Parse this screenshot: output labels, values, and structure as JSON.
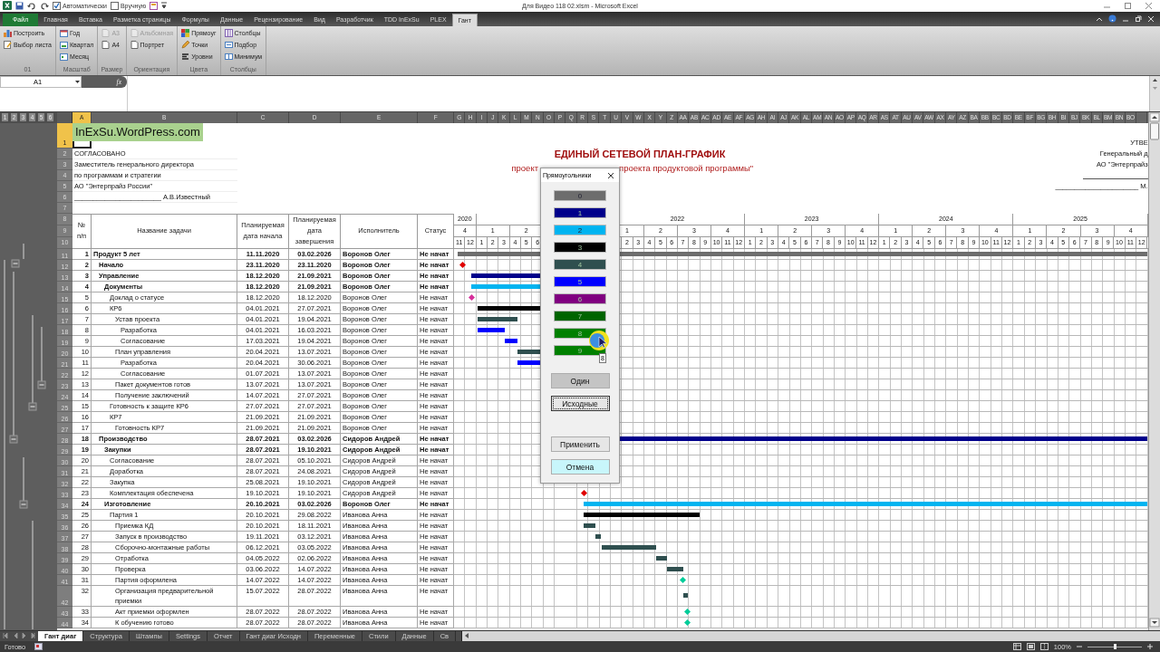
{
  "title_bar": {
    "title": "Для Видео 118 02.xlsm - Microsoft Excel",
    "checks": [
      {
        "label": "Автоматически",
        "checked": true
      },
      {
        "label": "Вручную",
        "checked": false
      }
    ]
  },
  "ribbon": {
    "tabs": [
      {
        "label": "Файл",
        "kind": "file",
        "selected": false
      },
      {
        "label": "Главная",
        "kind": "tab",
        "selected": false
      },
      {
        "label": "Вставка",
        "kind": "tab",
        "selected": false
      },
      {
        "label": "Разметка страницы",
        "kind": "tab",
        "selected": false
      },
      {
        "label": "Формулы",
        "kind": "tab",
        "selected": false
      },
      {
        "label": "Данные",
        "kind": "tab",
        "selected": false
      },
      {
        "label": "Рецензирование",
        "kind": "tab",
        "selected": false
      },
      {
        "label": "Вид",
        "kind": "tab",
        "selected": false
      },
      {
        "label": "Разработчик",
        "kind": "tab",
        "selected": false
      },
      {
        "label": "TDD InExSu",
        "kind": "tab",
        "selected": false
      },
      {
        "label": "PLEX",
        "kind": "tab",
        "selected": false
      },
      {
        "label": "Гант",
        "kind": "tab",
        "selected": true
      }
    ],
    "groups": [
      {
        "label": "01",
        "buttons": [
          {
            "label": "Построить",
            "disabled": false
          },
          {
            "label": "Выбор листа",
            "disabled": false
          }
        ]
      },
      {
        "label": "Масштаб",
        "buttons": [
          {
            "label": "Год",
            "disabled": false
          },
          {
            "label": "Квартал",
            "disabled": false
          },
          {
            "label": "Месяц",
            "disabled": false
          }
        ]
      },
      {
        "label": "Размер",
        "buttons": [
          {
            "label": "A3",
            "disabled": true
          },
          {
            "label": "A4",
            "disabled": false
          }
        ]
      },
      {
        "label": "Ориентация",
        "buttons": [
          {
            "label": "Альбомная",
            "disabled": true
          },
          {
            "label": "Портрет",
            "disabled": false
          }
        ]
      },
      {
        "label": "Цвета",
        "buttons": [
          {
            "label": "Прямоуг",
            "disabled": false
          },
          {
            "label": "Точки",
            "disabled": false
          },
          {
            "label": "Уровни",
            "disabled": false
          }
        ]
      },
      {
        "label": "Столбцы",
        "buttons": [
          {
            "label": "Столбцы",
            "disabled": false
          },
          {
            "label": "Подбор",
            "disabled": false
          },
          {
            "label": "Минимум",
            "disabled": false
          }
        ]
      }
    ]
  },
  "formula_bar": {
    "name_box": "A1",
    "fx": "fx"
  },
  "sheet": {
    "outline_levels": [
      "1",
      "2",
      "3",
      "4",
      "5",
      "6"
    ],
    "columns": [
      {
        "label": "A",
        "selected": true
      },
      {
        "label": "B",
        "selected": false
      },
      {
        "label": "C",
        "selected": false
      },
      {
        "label": "D",
        "selected": false
      },
      {
        "label": "E",
        "selected": false
      },
      {
        "label": "F",
        "selected": false
      },
      {
        "label": "G",
        "selected": false
      },
      {
        "label": "H",
        "selected": false
      },
      {
        "label": "I",
        "selected": false
      },
      {
        "label": "J",
        "selected": false
      },
      {
        "label": "K",
        "selected": false
      },
      {
        "label": "L",
        "selected": false
      },
      {
        "label": "M",
        "selected": false
      },
      {
        "label": "N",
        "selected": false
      },
      {
        "label": "O",
        "selected": false
      },
      {
        "label": "P",
        "selected": false
      },
      {
        "label": "Q",
        "selected": false
      },
      {
        "label": "R",
        "selected": false
      },
      {
        "label": "S",
        "selected": false
      },
      {
        "label": "T",
        "selected": false
      },
      {
        "label": "U",
        "selected": false
      },
      {
        "label": "V",
        "selected": false
      },
      {
        "label": "W",
        "selected": false
      },
      {
        "label": "X",
        "selected": false
      },
      {
        "label": "Y",
        "selected": false
      },
      {
        "label": "Z",
        "selected": false
      },
      {
        "label": "AA",
        "selected": false
      },
      {
        "label": "AB",
        "selected": false
      },
      {
        "label": "AC",
        "selected": false
      },
      {
        "label": "AD",
        "selected": false
      },
      {
        "label": "AE",
        "selected": false
      },
      {
        "label": "AF",
        "selected": false
      },
      {
        "label": "AG",
        "selected": false
      },
      {
        "label": "AH",
        "selected": false
      },
      {
        "label": "AI",
        "selected": false
      },
      {
        "label": "AJ",
        "selected": false
      },
      {
        "label": "AK",
        "selected": false
      },
      {
        "label": "AL",
        "selected": false
      },
      {
        "label": "AM",
        "selected": false
      },
      {
        "label": "AN",
        "selected": false
      },
      {
        "label": "AO",
        "selected": false
      },
      {
        "label": "AP",
        "selected": false
      },
      {
        "label": "AQ",
        "selected": false
      },
      {
        "label": "AR",
        "selected": false
      },
      {
        "label": "AS",
        "selected": false
      },
      {
        "label": "AT",
        "selected": false
      },
      {
        "label": "AU",
        "selected": false
      },
      {
        "label": "AV",
        "selected": false
      },
      {
        "label": "AW",
        "selected": false
      },
      {
        "label": "AX",
        "selected": false
      },
      {
        "label": "AY",
        "selected": false
      },
      {
        "label": "AZ",
        "selected": false
      },
      {
        "label": "BA",
        "selected": false
      },
      {
        "label": "BB",
        "selected": false
      },
      {
        "label": "BC",
        "selected": false
      },
      {
        "label": "BD",
        "selected": false
      },
      {
        "label": "BE",
        "selected": false
      },
      {
        "label": "BF",
        "selected": false
      },
      {
        "label": "BG",
        "selected": false
      },
      {
        "label": "BH",
        "selected": false
      },
      {
        "label": "BI",
        "selected": false
      },
      {
        "label": "BJ",
        "selected": false
      },
      {
        "label": "BK",
        "selected": false
      },
      {
        "label": "BL",
        "selected": false
      },
      {
        "label": "BM",
        "selected": false
      },
      {
        "label": "BN",
        "selected": false
      },
      {
        "label": "BO",
        "selected": false
      }
    ],
    "row_headers": [
      {
        "label": "1",
        "selected": true
      },
      {
        "label": "2",
        "selected": false
      },
      {
        "label": "3",
        "selected": false
      },
      {
        "label": "4",
        "selected": false
      },
      {
        "label": "5",
        "selected": false
      },
      {
        "label": "6",
        "selected": false
      },
      {
        "label": "7",
        "selected": false
      },
      {
        "label": "8",
        "selected": false
      },
      {
        "label": "9",
        "selected": false
      },
      {
        "label": "10",
        "selected": false
      },
      {
        "label": "11",
        "selected": false
      },
      {
        "label": "12",
        "selected": false
      },
      {
        "label": "13",
        "selected": false
      },
      {
        "label": "14",
        "selected": false
      },
      {
        "label": "15",
        "selected": false
      },
      {
        "label": "16",
        "selected": false
      },
      {
        "label": "17",
        "selected": false
      },
      {
        "label": "18",
        "selected": false
      },
      {
        "label": "19",
        "selected": false
      },
      {
        "label": "20",
        "selected": false
      },
      {
        "label": "21",
        "selected": false
      },
      {
        "label": "22",
        "selected": false
      },
      {
        "label": "23",
        "selected": false
      },
      {
        "label": "24",
        "selected": false
      },
      {
        "label": "25",
        "selected": false
      },
      {
        "label": "26",
        "selected": false
      },
      {
        "label": "27",
        "selected": false
      },
      {
        "label": "28",
        "selected": false
      },
      {
        "label": "29",
        "selected": false
      },
      {
        "label": "30",
        "selected": false
      },
      {
        "label": "31",
        "selected": false
      },
      {
        "label": "32",
        "selected": false
      },
      {
        "label": "33",
        "selected": false
      },
      {
        "label": "34",
        "selected": false
      },
      {
        "label": "35",
        "selected": false
      },
      {
        "label": "36",
        "selected": false
      },
      {
        "label": "37",
        "selected": false
      },
      {
        "label": "38",
        "selected": false
      },
      {
        "label": "39",
        "selected": false
      },
      {
        "label": "40",
        "selected": false
      },
      {
        "label": "41",
        "selected": false
      },
      {
        "label": "42",
        "selected": false
      },
      {
        "label": "43",
        "selected": false
      },
      {
        "label": "44",
        "selected": false
      }
    ],
    "logo_box": "InExSu.WordPress.com",
    "approval": [
      "СОГЛАСОВАНО",
      "Заместитель генерального директора",
      "по программам и стратегии",
      "АО \"Энтерпрайз России\"",
      "_______________________ А.В.Известный"
    ],
    "title": "ЕДИНЫЙ СЕТЕВОЙ ПЛАН-ГРАФИК",
    "subtitle_parts": [
      "проект",
      "проекта продуктовой программы\""
    ],
    "approve_right": [
      "УТВЕ",
      "Генеральный д",
      "АО \"Энтерпрайз",
      "______________________ М."
    ],
    "table_headers": [
      "№ п/п",
      "Название задачи",
      "Планируемая дата начала",
      "Планируемая дата завершения",
      "Исполнитель",
      "Статус"
    ],
    "years": [
      [
        "2020"
      ],
      [
        "2022",
        "2023",
        "2024",
        "2025"
      ]
    ],
    "quarters": [
      [
        "4",
        "1",
        "2"
      ],
      [
        "1",
        "2",
        "3",
        "4",
        "1",
        "2",
        "3",
        "4",
        "1",
        "2",
        "3",
        "4",
        "1",
        "2",
        "3",
        "4"
      ]
    ],
    "months": [
      [
        "11",
        "12",
        "1",
        "2",
        "3",
        "4",
        "5",
        "6"
      ],
      [
        "2",
        "3",
        "4",
        "5",
        "6",
        "7",
        "8",
        "9",
        "10",
        "11",
        "12",
        "1",
        "2",
        "3",
        "4",
        "5",
        "6",
        "7",
        "8",
        "9",
        "10",
        "11",
        "12",
        "1",
        "2",
        "3",
        "4",
        "5",
        "6",
        "7",
        "8",
        "9",
        "10",
        "11",
        "12",
        "1",
        "2",
        "3",
        "4",
        "5",
        "6",
        "7",
        "8",
        "9",
        "10",
        "11",
        "12"
      ]
    ],
    "tasks": [
      {
        "num": "1",
        "name": "Продукт 5 лет",
        "start": "11.11.2020",
        "end": "03.02.2026",
        "owner": "Воронов Олег",
        "status": "Не начат",
        "summary": true,
        "gantt": {
          "kind": "bar",
          "color": "#6d6d6d"
        },
        "children": [
          {
            "num": "2",
            "name": "Начало",
            "start": "23.11.2020",
            "end": "23.11.2020",
            "owner": "Воронов Олег",
            "status": "Не начат",
            "summary": true,
            "gantt": {
              "kind": "milestone",
              "color": "#e00000"
            }
          },
          {
            "num": "3",
            "name": "Управление",
            "start": "18.12.2020",
            "end": "21.09.2021",
            "owner": "Воронов Олег",
            "status": "Не начат",
            "summary": true,
            "gantt": {
              "kind": "bar",
              "color": "#00008b"
            },
            "children": [
              {
                "num": "4",
                "name": "Документы",
                "start": "18.12.2020",
                "end": "21.09.2021",
                "owner": "Воронов Олег",
                "status": "Не начат",
                "summary": true,
                "gantt": {
                  "kind": "bar",
                  "color": "#00b4f0"
                },
                "children": [
                  {
                    "num": "5",
                    "name": "Доклад о статусе",
                    "start": "18.12.2020",
                    "end": "18.12.2020",
                    "owner": "Воронов Олег",
                    "status": "Не начат",
                    "summary": false,
                    "gantt": {
                      "kind": "milestone",
                      "color": "#d62f9a"
                    }
                  },
                  {
                    "num": "6",
                    "name": "КР6",
                    "start": "04.01.2021",
                    "end": "27.07.2021",
                    "owner": "Воронов Олег",
                    "status": "Не начат",
                    "summary": false,
                    "gantt": {
                      "kind": "bar",
                      "color": "#000000"
                    },
                    "children": [
                      {
                        "num": "7",
                        "name": "Устав проекта",
                        "start": "04.01.2021",
                        "end": "19.04.2021",
                        "owner": "Воронов Олег",
                        "status": "Не начат",
                        "summary": false,
                        "gantt": {
                          "kind": "bar",
                          "color": "#2f4f4f"
                        },
                        "children": [
                          {
                            "num": "8",
                            "name": "Разработка",
                            "start": "04.01.2021",
                            "end": "16.03.2021",
                            "owner": "Воронов Олег",
                            "status": "Не начат",
                            "summary": false,
                            "gantt": {
                              "kind": "bar",
                              "color": "#0000ff"
                            }
                          },
                          {
                            "num": "9",
                            "name": "Согласование",
                            "start": "17.03.2021",
                            "end": "19.04.2021",
                            "owner": "Воронов Олег",
                            "status": "Не начат",
                            "summary": false,
                            "gantt": {
                              "kind": "bar",
                              "color": "#0000ff"
                            }
                          }
                        ]
                      },
                      {
                        "num": "10",
                        "name": "План управления",
                        "start": "20.04.2021",
                        "end": "13.07.2021",
                        "owner": "Воронов Олег",
                        "status": "Не начат",
                        "summary": false,
                        "gantt": {
                          "kind": "bar",
                          "color": "#2f4f4f"
                        },
                        "children": [
                          {
                            "num": "11",
                            "name": "Разработка",
                            "start": "20.04.2021",
                            "end": "30.06.2021",
                            "owner": "Воронов Олег",
                            "status": "Не начат",
                            "summary": false,
                            "gantt": {
                              "kind": "bar",
                              "color": "#0000ff"
                            }
                          },
                          {
                            "num": "12",
                            "name": "Согласование",
                            "start": "01.07.2021",
                            "end": "13.07.2021",
                            "owner": "Воронов Олег",
                            "status": "Не начат",
                            "summary": false
                          }
                        ]
                      },
                      {
                        "num": "13",
                        "name": "Пакет документов готов",
                        "start": "13.07.2021",
                        "end": "13.07.2021",
                        "owner": "Воронов Олег",
                        "status": "Не начат",
                        "summary": false
                      },
                      {
                        "num": "14",
                        "name": "Получение заключений",
                        "start": "14.07.2021",
                        "end": "27.07.2021",
                        "owner": "Воронов Олег",
                        "status": "Не начат",
                        "summary": false
                      }
                    ]
                  },
                  {
                    "num": "15",
                    "name": "Готовность к защите КР6",
                    "start": "27.07.2021",
                    "end": "27.07.2021",
                    "owner": "Воронов Олег",
                    "status": "Не начат",
                    "summary": false
                  },
                  {
                    "num": "16",
                    "name": "КР7",
                    "start": "21.09.2021",
                    "end": "21.09.2021",
                    "owner": "Воронов Олег",
                    "status": "Не начат",
                    "summary": false,
                    "children": [
                      {
                        "num": "17",
                        "name": "Готовность КР7",
                        "start": "21.09.2021",
                        "end": "21.09.2021",
                        "owner": "Воронов Олег",
                        "status": "Не начат",
                        "summary": false
                      }
                    ]
                  }
                ]
              }
            ]
          },
          {
            "num": "18",
            "name": "Производство",
            "start": "28.07.2021",
            "end": "03.02.2026",
            "owner": "Сидоров Андрей",
            "status": "Не начат",
            "summary": true,
            "gantt": {
              "kind": "bar",
              "color": "#00008b"
            },
            "children": [
              {
                "num": "19",
                "name": "Закупки",
                "start": "28.07.2021",
                "end": "19.10.2021",
                "owner": "Сидоров Андрей",
                "status": "Не начат",
                "summary": true,
                "children": [
                  {
                    "num": "20",
                    "name": "Согласование",
                    "start": "28.07.2021",
                    "end": "05.10.2021",
                    "owner": "Сидоров Андрей",
                    "status": "Не начат",
                    "summary": false
                  },
                  {
                    "num": "21",
                    "name": "Доработка",
                    "start": "28.07.2021",
                    "end": "24.08.2021",
                    "owner": "Сидоров Андрей",
                    "status": "Не начат",
                    "summary": false
                  },
                  {
                    "num": "22",
                    "name": "Закупка",
                    "start": "25.08.2021",
                    "end": "19.10.2021",
                    "owner": "Сидоров Андрей",
                    "status": "Не начат",
                    "summary": false
                  },
                  {
                    "num": "23",
                    "name": "Комплектация обеспечена",
                    "start": "19.10.2021",
                    "end": "19.10.2021",
                    "owner": "Сидоров Андрей",
                    "status": "Не начат",
                    "summary": false,
                    "gantt": {
                      "kind": "milestone",
                      "color": "#e00000"
                    }
                  }
                ]
              },
              {
                "num": "24",
                "name": "Изготовление",
                "start": "20.10.2021",
                "end": "03.02.2026",
                "owner": "Воронов Олег",
                "status": "Не начат",
                "summary": true,
                "gantt": {
                  "kind": "bar",
                  "color": "#00b4f0"
                },
                "children": [
                  {
                    "num": "25",
                    "name": "Партия 1",
                    "start": "20.10.2021",
                    "end": "29.08.2022",
                    "owner": "Иванова Анна",
                    "status": "Не начат",
                    "summary": false,
                    "gantt": {
                      "kind": "bar",
                      "color": "#000000"
                    },
                    "children": [
                      {
                        "num": "26",
                        "name": "Приемка КД",
                        "start": "20.10.2021",
                        "end": "18.11.2021",
                        "owner": "Иванова Анна",
                        "status": "Не начат",
                        "summary": false,
                        "gantt": {
                          "kind": "bar",
                          "color": "#2f4f4f"
                        }
                      },
                      {
                        "num": "27",
                        "name": "Запуск в производство",
                        "start": "19.11.2021",
                        "end": "03.12.2021",
                        "owner": "Иванова Анна",
                        "status": "Не начат",
                        "summary": false,
                        "gantt": {
                          "kind": "bar",
                          "color": "#2f4f4f"
                        }
                      },
                      {
                        "num": "28",
                        "name": "Сборочно-монтажные работы",
                        "start": "06.12.2021",
                        "end": "03.05.2022",
                        "owner": "Иванова Анна",
                        "status": "Не начат",
                        "summary": false,
                        "gantt": {
                          "kind": "bar",
                          "color": "#2f4f4f"
                        }
                      },
                      {
                        "num": "29",
                        "name": "Отработка",
                        "start": "04.05.2022",
                        "end": "02.06.2022",
                        "owner": "Иванова Анна",
                        "status": "Не начат",
                        "summary": false,
                        "gantt": {
                          "kind": "bar",
                          "color": "#2f4f4f"
                        }
                      },
                      {
                        "num": "30",
                        "name": "Проверка",
                        "start": "03.06.2022",
                        "end": "14.07.2022",
                        "owner": "Иванова Анна",
                        "status": "Не начат",
                        "summary": false,
                        "gantt": {
                          "kind": "bar",
                          "color": "#2f4f4f"
                        }
                      },
                      {
                        "num": "31",
                        "name": "Партия оформлена",
                        "start": "14.07.2022",
                        "end": "14.07.2022",
                        "owner": "Иванова Анна",
                        "status": "Не начат",
                        "summary": false,
                        "gantt": {
                          "kind": "milestone",
                          "color": "#00cc99"
                        }
                      },
                      {
                        "num": "32",
                        "name": "Организация предварительной приемки",
                        "start": "15.07.2022",
                        "end": "28.07.2022",
                        "owner": "Иванова Анна",
                        "status": "Не начат",
                        "summary": false,
                        "gantt": {
                          "kind": "bar",
                          "color": "#2f4f4f"
                        }
                      },
                      {
                        "num": "33",
                        "name": "Акт приемки оформлен",
                        "start": "28.07.2022",
                        "end": "28.07.2022",
                        "owner": "Иванова Анна",
                        "status": "Не начат",
                        "summary": false,
                        "gantt": {
                          "kind": "milestone",
                          "color": "#00cc99"
                        }
                      },
                      {
                        "num": "34",
                        "name": "К обучению готово",
                        "start": "28.07.2022",
                        "end": "28.07.2022",
                        "owner": "Иванова Анна",
                        "status": "Не начат",
                        "summary": false,
                        "gantt": {
                          "kind": "milestone",
                          "color": "#00cc99"
                        }
                      }
                    ]
                  }
                ]
              }
            ]
          }
        ]
      }
    ]
  },
  "dialog": {
    "title": "Прямоугольники",
    "swatches": [
      {
        "label": "0",
        "color": "#6d6d6d"
      },
      {
        "label": "1",
        "color": "#00008b"
      },
      {
        "label": "2",
        "color": "#00b4f0"
      },
      {
        "label": "3",
        "color": "#000000"
      },
      {
        "label": "4",
        "color": "#2f4f4f"
      },
      {
        "label": "5",
        "color": "#0000ff"
      },
      {
        "label": "6",
        "color": "#800080"
      },
      {
        "label": "7",
        "color": "#006400"
      },
      {
        "label": "8",
        "color": "#008000"
      },
      {
        "label": "9",
        "color": "#008000"
      }
    ],
    "tooltip": "8",
    "buttons_top": [
      {
        "label": "Один",
        "kind": "gray"
      },
      {
        "label": "Исходные",
        "kind": "focused"
      }
    ],
    "buttons_bottom": [
      {
        "label": "Применить",
        "kind": "plain"
      },
      {
        "label": "Отмена",
        "kind": "cancel"
      }
    ]
  },
  "sheet_tabs": [
    {
      "label": "Гант диаг",
      "selected": true
    },
    {
      "label": "Структура",
      "selected": false
    },
    {
      "label": "Штампы",
      "selected": false
    },
    {
      "label": "Settings",
      "selected": false
    },
    {
      "label": "Отчет",
      "selected": false
    },
    {
      "label": "Гант диаг Исходн",
      "selected": false
    },
    {
      "label": "Переменные",
      "selected": false
    },
    {
      "label": "Стили",
      "selected": false
    },
    {
      "label": "Данные",
      "selected": false
    },
    {
      "label": "Св",
      "selected": false
    }
  ],
  "status_bar": {
    "text": "Готово",
    "zoom": {
      "label": "100%",
      "level": 0.5
    }
  }
}
